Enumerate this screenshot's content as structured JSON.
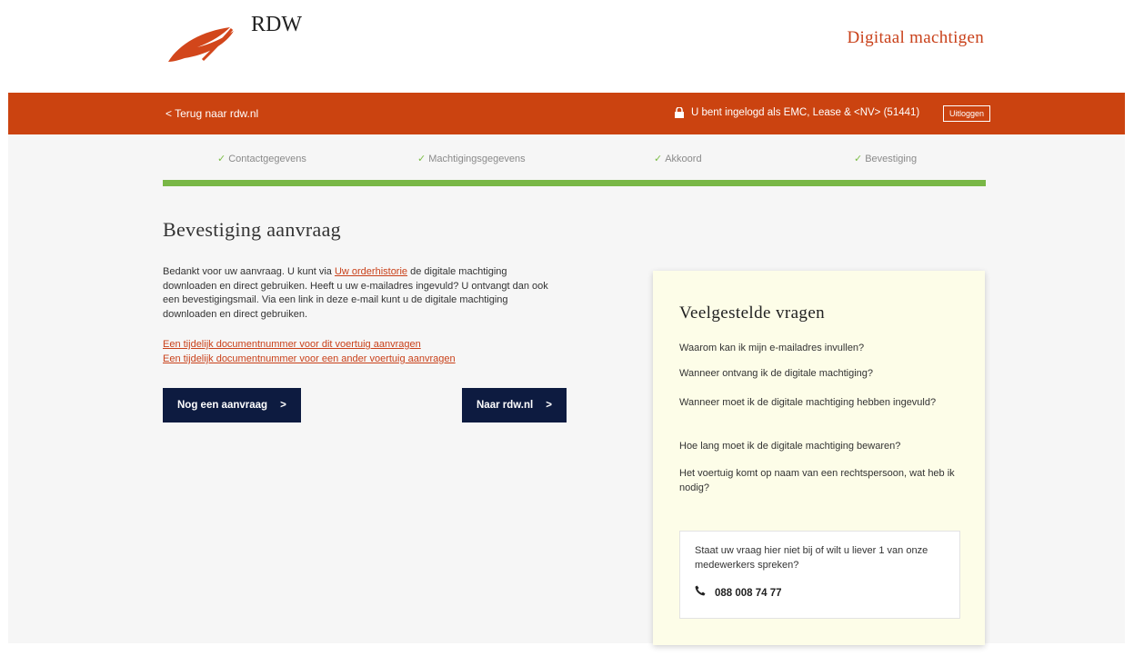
{
  "header": {
    "logo_text": "RDW",
    "app_title": "Digitaal machtigen"
  },
  "topbar": {
    "back_link": "< Terug naar rdw.nl",
    "login_text": "U bent ingelogd als EMC, Lease & <NV> (51441)",
    "logout": "Uitloggen"
  },
  "steps": [
    {
      "label": "Contactgegevens"
    },
    {
      "label": "Machtigingsgegevens"
    },
    {
      "label": "Akkoord"
    },
    {
      "label": "Bevestiging"
    }
  ],
  "progress_fraction": 1.0,
  "main": {
    "title": "Bevestiging aanvraag",
    "intro_part1": "Bedankt voor uw aanvraag. U kunt via ",
    "intro_link": "Uw orderhistorie",
    "intro_part2": " de digitale machtiging downloaden en direct gebruiken. Heeft u uw e-mailadres ingevuld? U ontvangt dan ook een bevestigingsmail. Via een link in deze e-mail kunt u de digitale machtiging downloaden en direct gebruiken.",
    "link1": "Een tijdelijk documentnummer voor dit voertuig aanvragen",
    "link2": "Een tijdelijk documentnummer voor een ander voertuig aanvragen",
    "btn_new": "Nog een aanvraag",
    "btn_rdw": "Naar rdw.nl"
  },
  "faq": {
    "title": "Veelgestelde vragen",
    "questions": [
      "Waarom kan ik mijn e-mailadres invullen?",
      "Wanneer ontvang ik de digitale machtiging?",
      "Wanneer moet ik de digitale machtiging hebben ingevuld?",
      "Hoe lang moet ik de digitale machtiging bewaren?",
      "Het voertuig komt op naam van een rechtspersoon, wat heb ik nodig?"
    ],
    "contact_text": "Staat uw vraag hier niet bij of wilt u liever 1 van onze medewerkers spreken?",
    "phone": "088 008 74 77"
  },
  "colors": {
    "brand": "#cb4310",
    "progress": "#79b746",
    "button": "#0d1b40",
    "faq_bg": "#fdfde8"
  }
}
